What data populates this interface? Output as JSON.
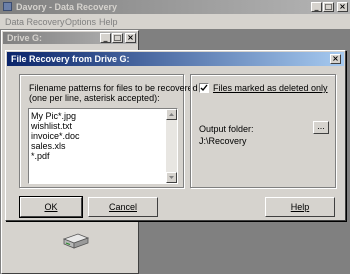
{
  "main_window": {
    "title": "Davory - Data Recovery",
    "menu": [
      {
        "label": "Data Recovery"
      },
      {
        "label": "Options"
      },
      {
        "label": "Help"
      }
    ]
  },
  "drive_window": {
    "title": "Drive G:",
    "icon": "hard-drive-icon"
  },
  "dialog": {
    "title": "File Recovery from Drive G:",
    "patterns_label_line1": "Filename patterns for files to be recovered",
    "patterns_label_line2": "(one per line, asterisk accepted):",
    "patterns": [
      "My Pic*.jpg",
      "wishlist.txt",
      "invoice*.doc",
      "sales.xls",
      "*.pdf"
    ],
    "deleted_only_label": "Files marked as deleted only",
    "deleted_only_checked": true,
    "output_folder_label": "Output folder:",
    "output_folder_value": "J:\\Recovery",
    "browse_label": "...",
    "ok_label": "OK",
    "cancel_label": "Cancel",
    "help_label": "Help"
  },
  "caption_glyphs": {
    "minimize": "_",
    "maximize": "□",
    "close": "×"
  }
}
